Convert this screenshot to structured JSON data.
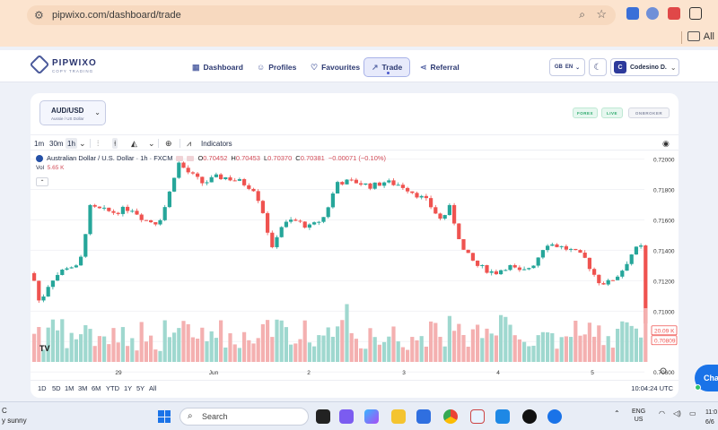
{
  "browser": {
    "url": "pipwixo.com/dashboard/trade",
    "bookmarks_label": "All"
  },
  "app": {
    "logo_name": "PIPWIXO",
    "logo_tagline": "COPY TRADING",
    "nav": [
      {
        "label": "Dashboard",
        "icon": "grid-icon"
      },
      {
        "label": "Profiles",
        "icon": "users-icon"
      },
      {
        "label": "Favourites",
        "icon": "heart-icon"
      },
      {
        "label": "Trade",
        "icon": "trend-icon",
        "active": true
      },
      {
        "label": "Referral",
        "icon": "share-icon"
      }
    ],
    "language": {
      "flag": "GB",
      "code": "EN"
    },
    "user": {
      "initial": "C",
      "name": "Codesino D."
    }
  },
  "trade": {
    "pair": {
      "symbol": "AUD/USD",
      "description": "Aussie / US Dollar"
    },
    "markets": [
      "FOREX",
      "LIVE",
      "ONBROKER"
    ],
    "timeframes": [
      "1m",
      "30m",
      "1h"
    ],
    "selected_timeframe": "1h",
    "indicators_label": "Indicators",
    "legend": {
      "title": "Australian Dollar / U.S. Dollar · 1h · FXCM",
      "o_label": "O",
      "o": "0.70452",
      "h_label": "H",
      "h": "0.70453",
      "l_label": "L",
      "l": "0.70370",
      "c_label": "C",
      "c": "0.70381",
      "change": "−0.00071 (−0.10%)"
    },
    "volume_label": "Vol",
    "volume_value": "5.65 K",
    "price_tag": "0.70809",
    "volume_tag": "20.09 K",
    "periods": [
      "1D",
      "5D",
      "1M",
      "3M",
      "6M",
      "YTD",
      "1Y",
      "5Y",
      "All"
    ],
    "clock": "10:04:24 UTC"
  },
  "chart_data": {
    "type": "candlestick",
    "y_ticks": [
      "0.72000",
      "0.71800",
      "0.71600",
      "0.71400",
      "0.71200",
      "0.71000",
      "0.70800",
      "0.70600"
    ],
    "x_ticks": [
      "29",
      "Jun",
      "2",
      "3",
      "4",
      "5"
    ],
    "y_range": [
      0.7056,
      0.7208
    ],
    "up_color": "#26a69a",
    "down_color": "#ef5350"
  },
  "chat_label": "Chat",
  "taskbar": {
    "weather_line1": "C",
    "weather_line2": "y sunny",
    "search_label": "Search",
    "lang_line1": "ENG",
    "lang_line2": "US",
    "time_line1": "11:0",
    "time_line2": "6/6"
  }
}
